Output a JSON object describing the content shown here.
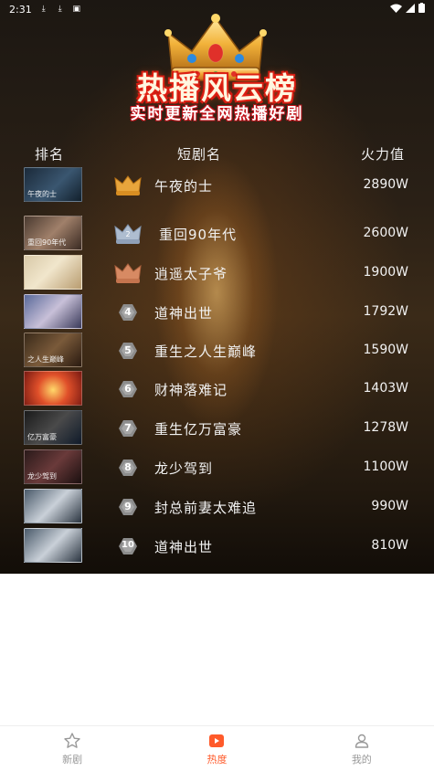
{
  "status_bar": {
    "time": "2:31"
  },
  "hero": {
    "title": "热播风云榜",
    "subtitle": "实时更新全网热播好剧"
  },
  "columns": {
    "rank": "排名",
    "name": "短剧名",
    "fire": "火力值"
  },
  "rankings": [
    {
      "rank": "1",
      "name": "午夜的士",
      "fire": "2890W",
      "thumb_text": "午夜的士"
    },
    {
      "rank": "2",
      "name": "重回90年代",
      "fire": "2600W",
      "thumb_text": "重回90年代"
    },
    {
      "rank": "3",
      "name": "逍遥太子爷",
      "fire": "1900W",
      "thumb_text": ""
    },
    {
      "rank": "4",
      "name": "道神出世",
      "fire": "1792W",
      "thumb_text": ""
    },
    {
      "rank": "5",
      "name": "重生之人生巅峰",
      "fire": "1590W",
      "thumb_text": "之人生巅峰"
    },
    {
      "rank": "6",
      "name": "财神落难记",
      "fire": "1403W",
      "thumb_text": ""
    },
    {
      "rank": "7",
      "name": "重生亿万富豪",
      "fire": "1278W",
      "thumb_text": "亿万富豪"
    },
    {
      "rank": "8",
      "name": "龙少驾到",
      "fire": "1100W",
      "thumb_text": "龙少驾到"
    },
    {
      "rank": "9",
      "name": "封总前妻太难追",
      "fire": "990W",
      "thumb_text": ""
    },
    {
      "rank": "10",
      "name": "道神出世",
      "fire": "810W",
      "thumb_text": ""
    }
  ],
  "bottom_nav": {
    "items": [
      {
        "label": "新剧",
        "icon": "star-icon"
      },
      {
        "label": "热度",
        "icon": "play-icon"
      },
      {
        "label": "我的",
        "icon": "user-icon"
      }
    ]
  },
  "colors": {
    "accent": "#ff5a2a",
    "gold": "#e8a53c",
    "silver": "#aebdd0",
    "bronze": "#d78a63",
    "grey_badge": "#8c8c8c"
  }
}
